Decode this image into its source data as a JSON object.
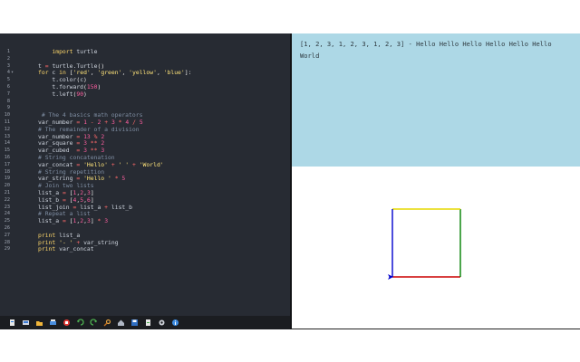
{
  "editor": {
    "lines": [
      {
        "n": "1",
        "t": "    import turtle"
      },
      {
        "n": "2",
        "t": ""
      },
      {
        "n": "3",
        "t": "t = turtle.Turtle()"
      },
      {
        "n": "4",
        "t": "for c in ['red', 'green', 'yellow', 'blue']:"
      },
      {
        "n": "5",
        "t": "    t.color(c)"
      },
      {
        "n": "6",
        "t": "    t.forward(150)"
      },
      {
        "n": "7",
        "t": "    t.left(90)"
      },
      {
        "n": "8",
        "t": ""
      },
      {
        "n": "9",
        "t": ""
      },
      {
        "n": "10",
        "t": " # The 4 basics math operators"
      },
      {
        "n": "11",
        "t": "var_number = 1 - 2 + 3 * 4 / 5"
      },
      {
        "n": "12",
        "t": "# The remainder of a division"
      },
      {
        "n": "13",
        "t": "var_number = 13 % 2"
      },
      {
        "n": "14",
        "t": "var_square = 3 ** 2"
      },
      {
        "n": "15",
        "t": "var_cubed  = 3 ** 3"
      },
      {
        "n": "16",
        "t": "# String concatenation"
      },
      {
        "n": "17",
        "t": "var_concat = 'Hello' + ' ' + 'World'"
      },
      {
        "n": "18",
        "t": "# String repetition"
      },
      {
        "n": "19",
        "t": "var_string = 'Hello ' * 5"
      },
      {
        "n": "20",
        "t": "# Join two lists"
      },
      {
        "n": "21",
        "t": "list_a = [1,2,3]"
      },
      {
        "n": "22",
        "t": "list_b = [4,5,6]"
      },
      {
        "n": "23",
        "t": "list_join = list_a + list_b"
      },
      {
        "n": "24",
        "t": "# Repeat a list"
      },
      {
        "n": "25",
        "t": "list_a = [1,2,3] * 3"
      },
      {
        "n": "26",
        "t": ""
      },
      {
        "n": "27",
        "t": "print list_a"
      },
      {
        "n": "28",
        "t": "print '- ' + var_string"
      },
      {
        "n": "29",
        "t": "print var_concat"
      }
    ],
    "fold_marker": "▾"
  },
  "toolbar": {
    "icons": [
      "new-file-icon",
      "open-icon",
      "folder-icon",
      "print-icon",
      "stop-icon",
      "undo-icon",
      "redo-icon",
      "search-icon",
      "home-icon",
      "save-icon",
      "share-icon",
      "settings-icon",
      "info-icon"
    ]
  },
  "output": {
    "text": "[1, 2, 3, 1, 2, 3, 1, 2, 3] - Hello Hello Hello Hello Hello Hello World"
  },
  "turtle": {
    "colors": {
      "red": "#cc0000",
      "green": "#008000",
      "yellow": "#e6d800",
      "blue": "#0000cc"
    },
    "cursor_color": "#0000cc"
  },
  "colors": {
    "editor_bg": "#272b33",
    "output_bg": "#add8e6"
  }
}
